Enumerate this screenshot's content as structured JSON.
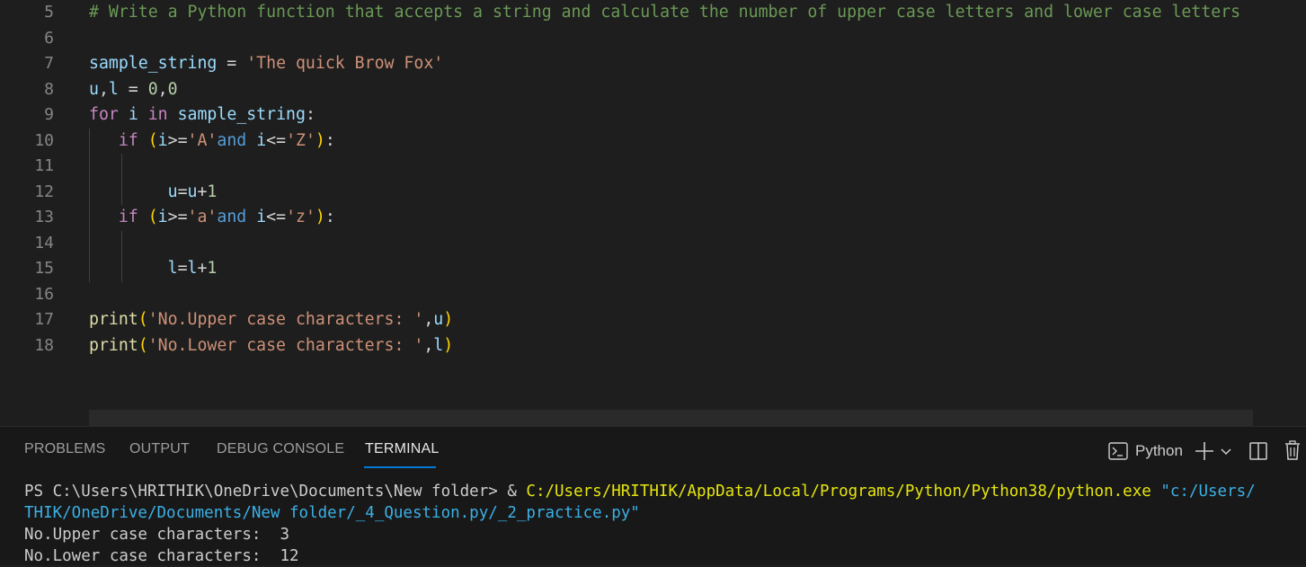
{
  "editor": {
    "lines": [
      {
        "num": "5",
        "tokens": [
          {
            "t": "# Write a Python function that accepts a string and calculate the number of upper case letters and lower case letters",
            "c": "com"
          }
        ]
      },
      {
        "num": "6",
        "tokens": []
      },
      {
        "num": "7",
        "tokens": [
          {
            "t": "sample_string",
            "c": "var"
          },
          {
            "t": " = ",
            "c": "op"
          },
          {
            "t": "'The quick Brow Fox'",
            "c": "str"
          }
        ]
      },
      {
        "num": "8",
        "tokens": [
          {
            "t": "u",
            "c": "var"
          },
          {
            "t": ",",
            "c": "op"
          },
          {
            "t": "l",
            "c": "var"
          },
          {
            "t": " = ",
            "c": "op"
          },
          {
            "t": "0",
            "c": "num"
          },
          {
            "t": ",",
            "c": "op"
          },
          {
            "t": "0",
            "c": "num"
          }
        ]
      },
      {
        "num": "9",
        "tokens": [
          {
            "t": "for",
            "c": "kw"
          },
          {
            "t": " ",
            "c": "op"
          },
          {
            "t": "i",
            "c": "var"
          },
          {
            "t": " ",
            "c": "op"
          },
          {
            "t": "in",
            "c": "kw"
          },
          {
            "t": " ",
            "c": "op"
          },
          {
            "t": "sample_string",
            "c": "var"
          },
          {
            "t": ":",
            "c": "op"
          }
        ]
      },
      {
        "num": "10",
        "tokens": [
          {
            "t": "   ",
            "c": "op"
          },
          {
            "t": "if",
            "c": "kw"
          },
          {
            "t": " ",
            "c": "op"
          },
          {
            "t": "(",
            "c": "p1"
          },
          {
            "t": "i",
            "c": "var"
          },
          {
            "t": ">=",
            "c": "op"
          },
          {
            "t": "'A'",
            "c": "str"
          },
          {
            "t": "and",
            "c": "kw2"
          },
          {
            "t": " ",
            "c": "op"
          },
          {
            "t": "i",
            "c": "var"
          },
          {
            "t": "<=",
            "c": "op"
          },
          {
            "t": "'Z'",
            "c": "str"
          },
          {
            "t": ")",
            "c": "p1"
          },
          {
            "t": ":",
            "c": "op"
          }
        ]
      },
      {
        "num": "11",
        "tokens": []
      },
      {
        "num": "12",
        "tokens": [
          {
            "t": "        ",
            "c": "op"
          },
          {
            "t": "u",
            "c": "var"
          },
          {
            "t": "=",
            "c": "op"
          },
          {
            "t": "u",
            "c": "var"
          },
          {
            "t": "+",
            "c": "op"
          },
          {
            "t": "1",
            "c": "num"
          }
        ]
      },
      {
        "num": "13",
        "tokens": [
          {
            "t": "   ",
            "c": "op"
          },
          {
            "t": "if",
            "c": "kw"
          },
          {
            "t": " ",
            "c": "op"
          },
          {
            "t": "(",
            "c": "p1"
          },
          {
            "t": "i",
            "c": "var"
          },
          {
            "t": ">=",
            "c": "op"
          },
          {
            "t": "'a'",
            "c": "str"
          },
          {
            "t": "and",
            "c": "kw2"
          },
          {
            "t": " ",
            "c": "op"
          },
          {
            "t": "i",
            "c": "var"
          },
          {
            "t": "<=",
            "c": "op"
          },
          {
            "t": "'z'",
            "c": "str"
          },
          {
            "t": ")",
            "c": "p1"
          },
          {
            "t": ":",
            "c": "op"
          }
        ]
      },
      {
        "num": "14",
        "tokens": []
      },
      {
        "num": "15",
        "tokens": [
          {
            "t": "        ",
            "c": "op"
          },
          {
            "t": "l",
            "c": "var"
          },
          {
            "t": "=",
            "c": "op"
          },
          {
            "t": "l",
            "c": "var"
          },
          {
            "t": "+",
            "c": "op"
          },
          {
            "t": "1",
            "c": "num"
          }
        ]
      },
      {
        "num": "16",
        "tokens": []
      },
      {
        "num": "17",
        "tokens": [
          {
            "t": "print",
            "c": "fn"
          },
          {
            "t": "(",
            "c": "p1"
          },
          {
            "t": "'No.Upper case characters: '",
            "c": "str"
          },
          {
            "t": ",",
            "c": "op"
          },
          {
            "t": "u",
            "c": "var"
          },
          {
            "t": ")",
            "c": "p1"
          }
        ]
      },
      {
        "num": "18",
        "tokens": [
          {
            "t": "print",
            "c": "fn"
          },
          {
            "t": "(",
            "c": "p1"
          },
          {
            "t": "'No.Lower case characters: '",
            "c": "str"
          },
          {
            "t": ",",
            "c": "op"
          },
          {
            "t": "l",
            "c": "var"
          },
          {
            "t": ")",
            "c": "p1"
          }
        ]
      }
    ]
  },
  "panel": {
    "tabs": [
      {
        "label": "PROBLEMS",
        "active": false
      },
      {
        "label": "OUTPUT",
        "active": false
      },
      {
        "label": "DEBUG CONSOLE",
        "active": false
      },
      {
        "label": "TERMINAL",
        "active": true
      }
    ],
    "profile_label": "Python",
    "icons": {
      "terminal": "terminal-python-icon",
      "add": "add-terminal-icon",
      "dropdown": "chevron-down-icon",
      "split": "split-terminal-icon",
      "trash": "kill-terminal-icon"
    }
  },
  "terminal": {
    "lines": [
      [
        {
          "t": "PS C:\\Users\\HRITHIK\\OneDrive\\Documents\\New folder> & ",
          "c": "plain"
        },
        {
          "t": "C:/Users/HRITHIK/AppData/Local/Programs/Python/Python38/python.exe",
          "c": "yel"
        },
        {
          "t": " \"c:/Users/",
          "c": "cyan"
        }
      ],
      [
        {
          "t": "THIK/OneDrive/Documents/New folder/_4_Question.py/_2_practice.py\"",
          "c": "cyan"
        }
      ],
      [
        {
          "t": "No.Upper case characters:  3",
          "c": "plain"
        }
      ],
      [
        {
          "t": "No.Lower case characters:  12",
          "c": "plain"
        }
      ]
    ]
  }
}
